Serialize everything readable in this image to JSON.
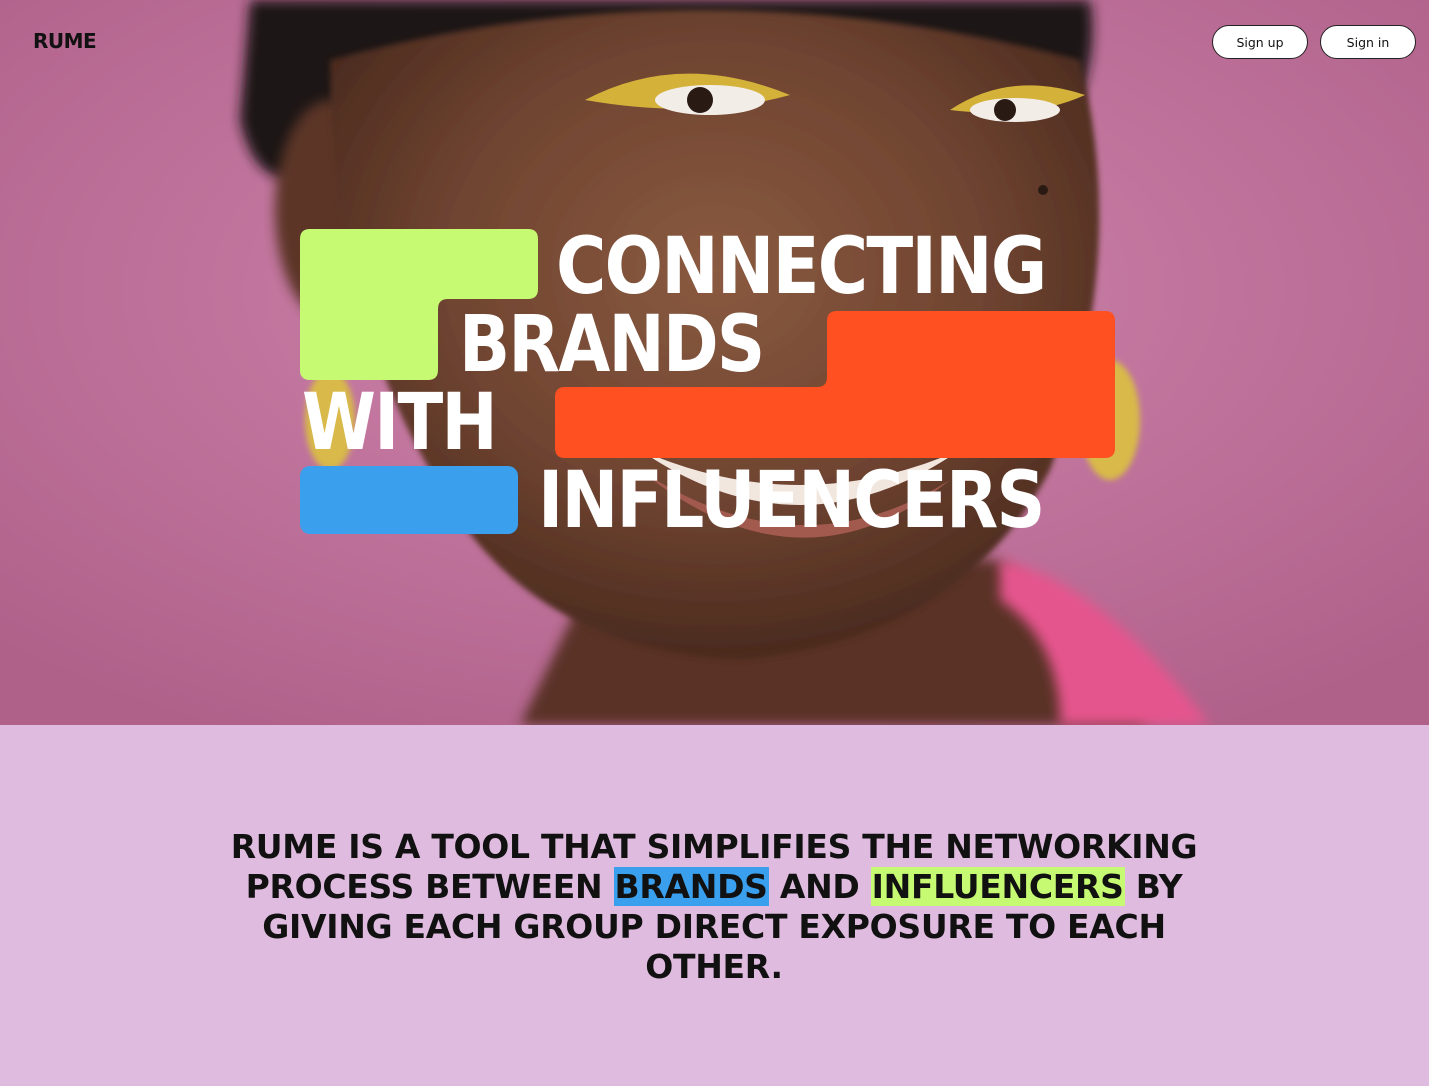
{
  "brand": {
    "logo": "RUME"
  },
  "nav": {
    "sign_up": "Sign up",
    "sign_in": "Sign in"
  },
  "hero": {
    "headline": {
      "line1": "CONNECTING",
      "line2": "BRANDS",
      "line3": "WITH",
      "line4": "INFLUENCERS"
    },
    "colors": {
      "background": "#c07298",
      "green_block": "#c6fa72",
      "orange_block": "#ff5022",
      "blue_block": "#3aa0ee"
    }
  },
  "about": {
    "part1": "RUME IS A TOOL THAT SIMPLIFIES THE NETWORKING PROCESS BETWEEN ",
    "highlight1": "BRANDS",
    "part2": " AND ",
    "highlight2": "INFLUENCERS",
    "part3": " BY GIVING EACH GROUP DIRECT EXPOSURE TO EACH OTHER.",
    "background": "#dfbcdf"
  }
}
